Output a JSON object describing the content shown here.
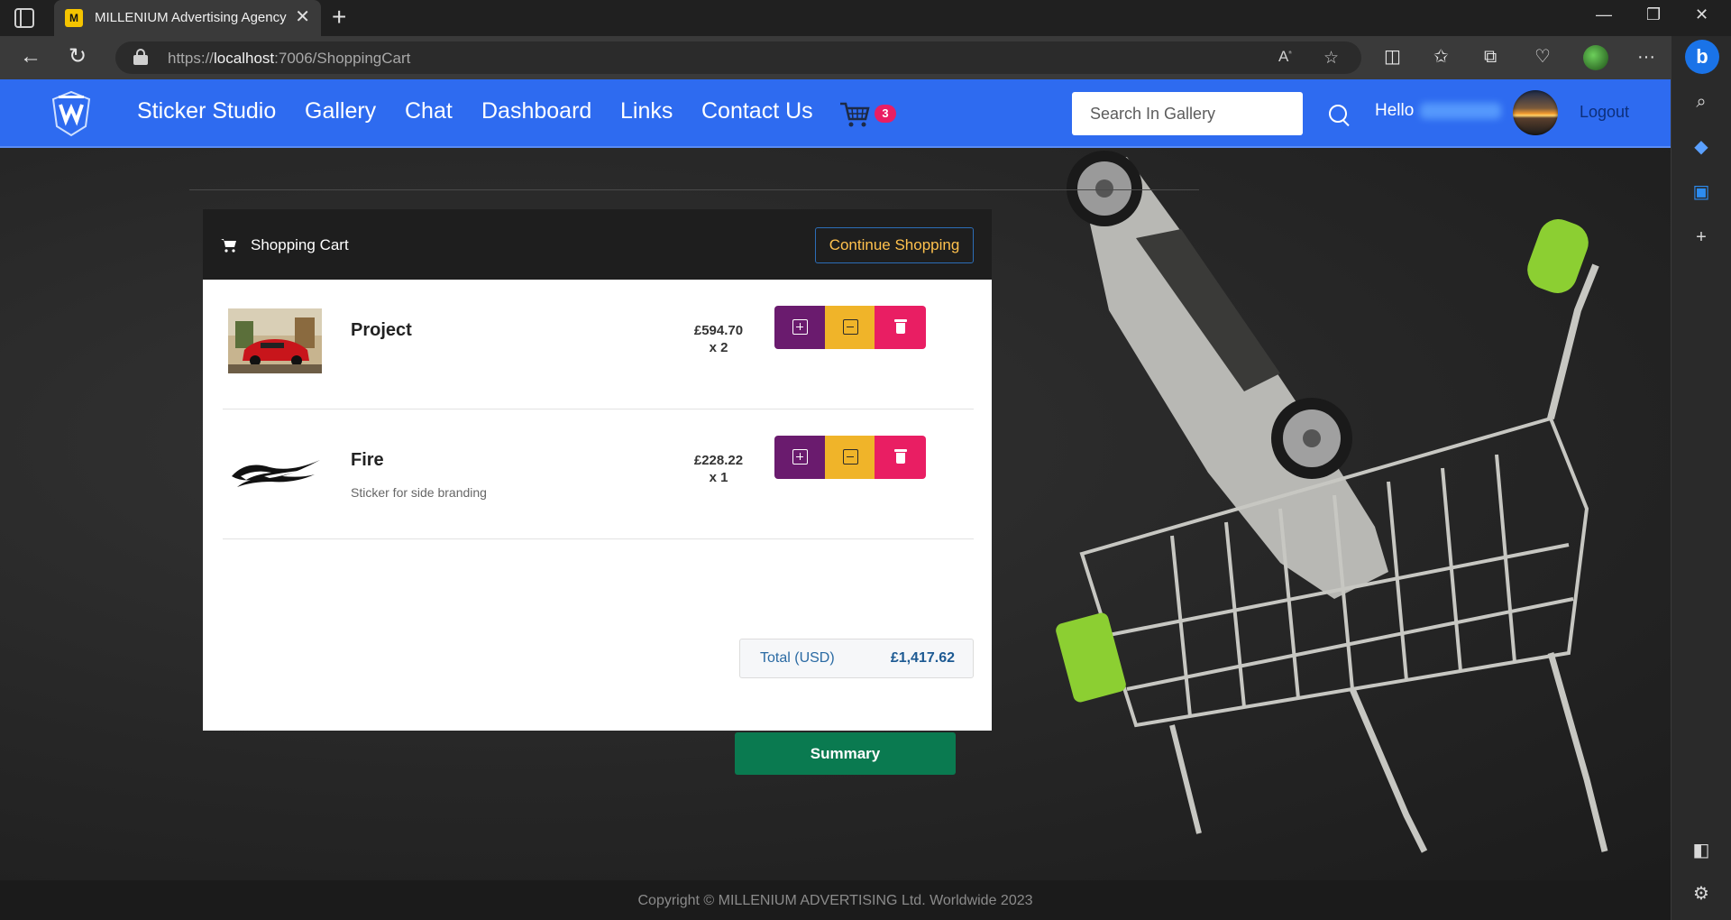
{
  "browser": {
    "tab_title": "MILLENIUM Advertising Agency",
    "favicon_text": "M",
    "url_prefix": "https://",
    "url_host": "localhost",
    "url_path": ":7006/ShoppingCart"
  },
  "navbar": {
    "links": [
      "Sticker Studio",
      "Gallery",
      "Chat",
      "Dashboard",
      "Links",
      "Contact Us"
    ],
    "cart_count": "3",
    "search_placeholder": "Search In Gallery",
    "hello": "Hello",
    "logout": "Logout"
  },
  "cart": {
    "title": "Shopping Cart",
    "continue_label": "Continue Shopping",
    "items": [
      {
        "name": "Project",
        "description": "",
        "price": "£594.70",
        "qty": "x 2"
      },
      {
        "name": "Fire",
        "description": "Sticker for side branding",
        "price": "£228.22",
        "qty": "x 1"
      }
    ],
    "total_label": "Total (USD)",
    "total_value": "£1,417.62",
    "summary_label": "Summary"
  },
  "footer": {
    "copyright": "Copyright © MILLENIUM ADVERTISING Ltd. Worldwide 2023"
  },
  "icons": {
    "cart": "shopping-cart-icon",
    "search": "search-icon",
    "plus": "plus-square-icon",
    "minus": "minus-square-icon",
    "delete": "trash-icon"
  },
  "colors": {
    "navbar": "#2e6bf0",
    "plus_button": "#6a1b6e",
    "minus_button": "#f0b429",
    "delete_button": "#e91e63",
    "summary_button": "#0a7a50",
    "badge": "#e91e63"
  }
}
